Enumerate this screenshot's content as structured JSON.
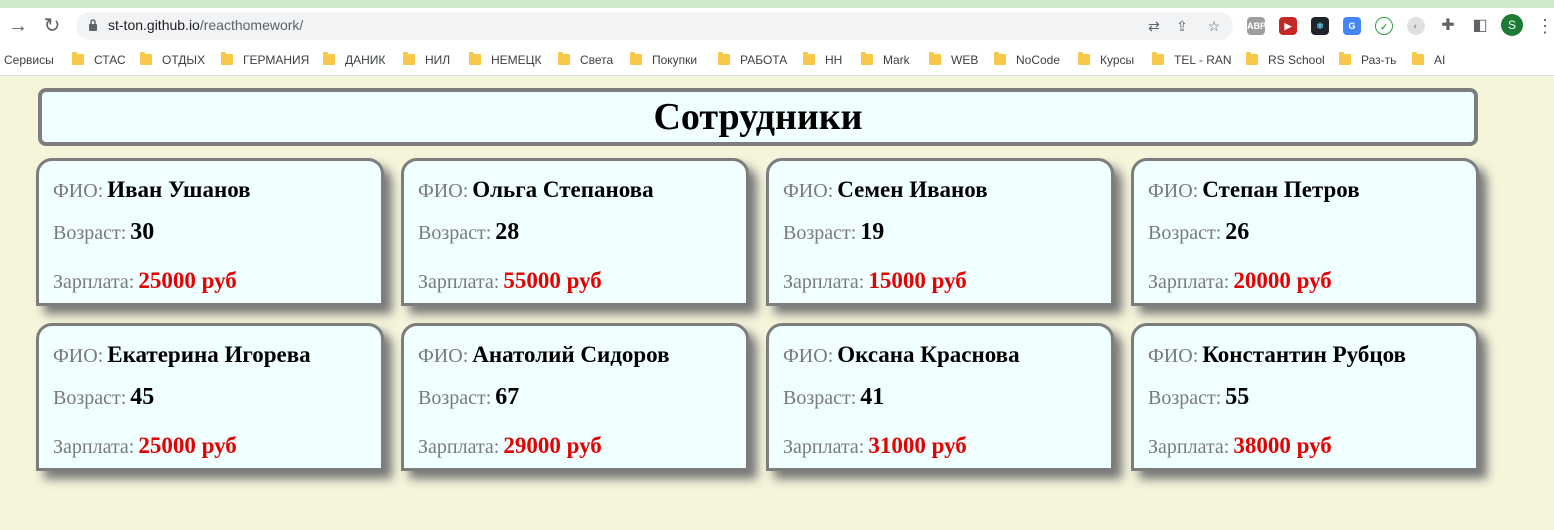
{
  "browser": {
    "url_host": "st-ton.github.io",
    "url_path": "/reacthomework/",
    "extensions": [
      "ABP",
      "▶",
      "⚛",
      "G",
      "✓",
      "◐"
    ],
    "avatar_letter": "S"
  },
  "bookmarks": {
    "apps_label": "Сервисы",
    "items": [
      "СТАС",
      "ОТДЫХ",
      "ГЕРМАНИЯ",
      "ДАНИК",
      "НИЛ",
      "НЕМЕЦК",
      "Света",
      "Покупки",
      "РАБОТА",
      "НН",
      "Mark",
      "WEB",
      "NoCode",
      "Курсы",
      "TEL - RAN",
      "RS School",
      "Раз-ть",
      "AI"
    ]
  },
  "page": {
    "title": "Сотрудники",
    "labels": {
      "name": "ФИО:",
      "age": "Возраст:",
      "salary": "Зарплата:"
    },
    "employees": [
      {
        "name": "Иван Ушанов",
        "age": "30",
        "salary": "25000 руб"
      },
      {
        "name": "Ольга Степанова",
        "age": "28",
        "salary": "55000 руб"
      },
      {
        "name": "Семен Иванов",
        "age": "19",
        "salary": "15000 руб"
      },
      {
        "name": "Степан Петров",
        "age": "26",
        "salary": "20000 руб"
      },
      {
        "name": "Екатерина Игорева",
        "age": "45",
        "salary": "25000 руб"
      },
      {
        "name": "Анатолий Сидоров",
        "age": "67",
        "salary": "29000 руб"
      },
      {
        "name": "Оксана Краснова",
        "age": "41",
        "salary": "31000 руб"
      },
      {
        "name": "Константин Рубцов",
        "age": "55",
        "salary": "38000 руб"
      }
    ]
  }
}
